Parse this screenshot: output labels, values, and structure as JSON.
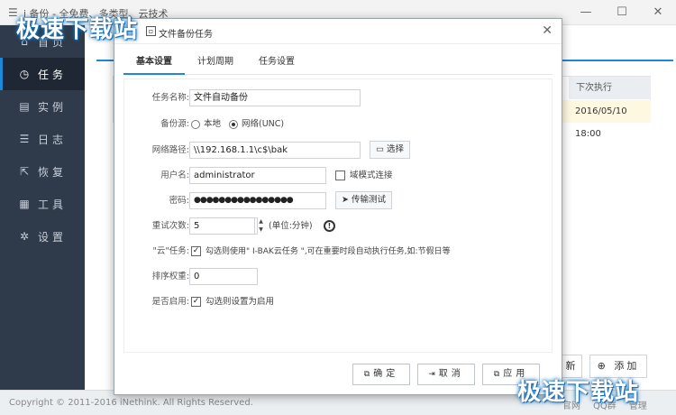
{
  "app": {
    "title": "i 备份 - 全免费、多类型、云技术",
    "sidebar": [
      {
        "icon": "home-icon",
        "glyph": "⌂",
        "label": "首页"
      },
      {
        "icon": "clock-icon",
        "glyph": "◷",
        "label": "任务",
        "active": true
      },
      {
        "icon": "instance-icon",
        "glyph": "▤",
        "label": "实例"
      },
      {
        "icon": "log-icon",
        "glyph": "☰",
        "label": "日志"
      },
      {
        "icon": "restore-icon",
        "glyph": "⇱",
        "label": "恢复"
      },
      {
        "icon": "tools-icon",
        "glyph": "▦",
        "label": "工具"
      },
      {
        "icon": "gear-icon",
        "glyph": "✲",
        "label": "设置"
      }
    ],
    "table": {
      "col_next_run": "下次执行",
      "cell_next_run": "2016/05/10 18:00"
    },
    "buttons": {
      "refresh_partial": "新",
      "add": "添加",
      "add_glyph": "⊕"
    },
    "footer": {
      "copyright": "Copyright © 2011-2016 iNethink. All Rights Reserved.",
      "links": [
        "官网",
        "QQ群",
        "管理"
      ]
    },
    "watermark": "极速下载站"
  },
  "dialog": {
    "title": "文件备份任务",
    "tabs": [
      "基本设置",
      "计划周期",
      "任务设置"
    ],
    "fields": {
      "task_name": {
        "label": "任务名称:",
        "value": "文件自动备份"
      },
      "source": {
        "label": "备份源:",
        "options": [
          "本地",
          "网络(UNC)"
        ],
        "selected": 1
      },
      "path": {
        "label": "网络路径:",
        "value": "\\\\192.168.1.1\\c$\\bak",
        "browse": "选择"
      },
      "username": {
        "label": "用户名:",
        "value": "administrator",
        "domain_mode": "域模式连接"
      },
      "password": {
        "label": "密码:",
        "value": "●●●●●●●●●●●●●●●●",
        "test": "传输测试"
      },
      "retry": {
        "label": "重试次数:",
        "value": "5",
        "unit": "(单位:分钟)"
      },
      "cloud": {
        "label": "\"云\"任务:",
        "text": "勾选则使用\" I-BAK云任务 \",可在重要时段自动执行任务,如:节假日等"
      },
      "priority": {
        "label": "排序权重:",
        "value": "0"
      },
      "enabled": {
        "label": "是否启用:",
        "text": "勾选则设置为启用"
      }
    },
    "footer": {
      "ok": "确定",
      "cancel": "取消",
      "apply": "应用"
    }
  }
}
